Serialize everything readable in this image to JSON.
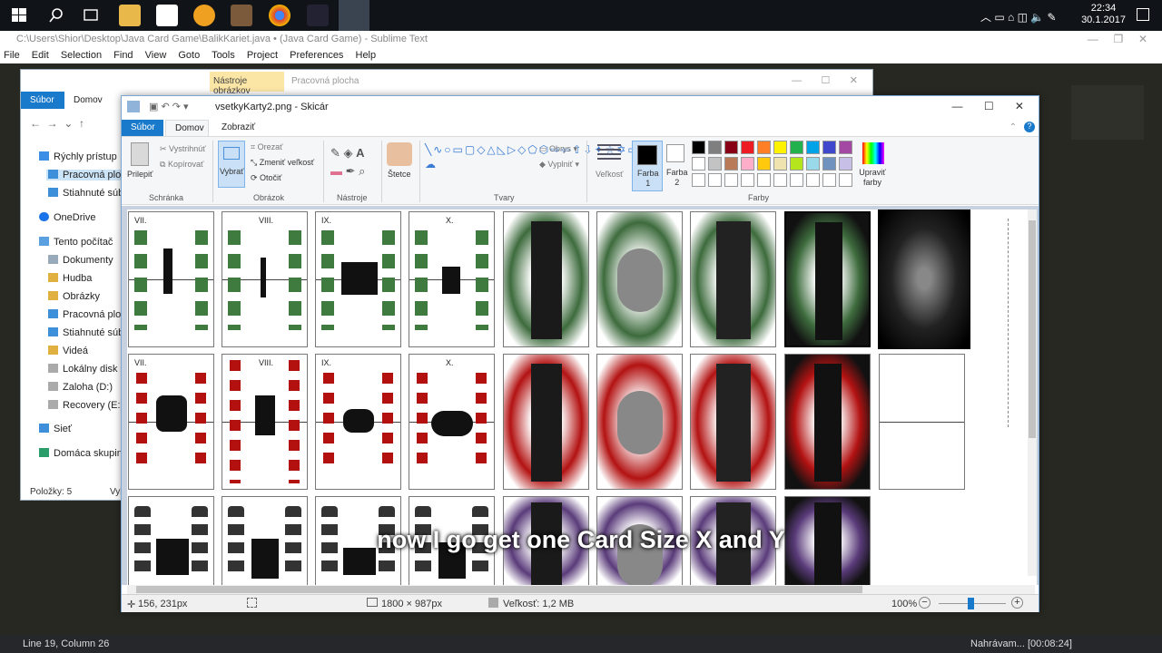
{
  "taskbar": {
    "time": "22:34",
    "date": "30.1.2017"
  },
  "sublime": {
    "title": "C:\\Users\\Shior\\Desktop\\Java Card Game\\BalikKariet.java • (Java Card Game) - Sublime Text",
    "menu": [
      "File",
      "Edit",
      "Selection",
      "Find",
      "View",
      "Goto",
      "Tools",
      "Project",
      "Preferences",
      "Help"
    ],
    "status_left": "Line 19, Column 26",
    "status_right": "Nahrávam... [00:08:24]"
  },
  "explorer": {
    "context_tab": "Nástroje obrázkov",
    "location_tab": "Pracovná plocha",
    "tabs": [
      "Súbor",
      "Domov"
    ],
    "nav": [
      "Rýchly prístup",
      "Pracovná ploch",
      "Stiahnuté súbor",
      "OneDrive",
      "Tento počítač",
      "Dokumenty",
      "Hudba",
      "Obrázky",
      "Pracovná ploch",
      "Stiahnuté súbor",
      "Videá",
      "Lokálny disk (C:",
      "Zaloha (D:)",
      "Recovery (E:)",
      "Sieť",
      "Domáca skupina"
    ],
    "status": "Položky: 5",
    "status2": "Vybratá"
  },
  "paint": {
    "title": "vsetkyKarty2.png - Skicár",
    "tabs": [
      "Súbor",
      "Domov",
      "Zobraziť"
    ],
    "groups": [
      "Schránka",
      "Obrázok",
      "Nástroje",
      "Tvary",
      "Farby"
    ],
    "paste": "Prilepiť",
    "cut": "Vystrihnúť",
    "copy": "Kopírovať",
    "select": "Vybrať",
    "crop": "Orezať",
    "resize": "Zmeniť veľkosť",
    "rotate": "Otočiť",
    "brushes": "Štetce",
    "outline": "Obrys",
    "fill": "Vyplniť",
    "size": "Veľkosť",
    "color1": "Farba",
    "color1n": "1",
    "color2": "Farba",
    "color2n": "2",
    "edit_colors": "Upraviť farby",
    "palette": [
      "#000000",
      "#7f7f7f",
      "#880015",
      "#ed1c24",
      "#ff7f27",
      "#fff200",
      "#22b14c",
      "#00a2e8",
      "#3f48cc",
      "#a349a4",
      "#ffffff",
      "#c3c3c3",
      "#b97a57",
      "#ffaec9",
      "#ffc90e",
      "#efe4b0",
      "#b5e61d",
      "#99d9ea",
      "#7092be",
      "#c8bfe7"
    ],
    "status_pos": "156, 231px",
    "status_dim": "1800 × 987px",
    "status_size": "Veľkosť: 1,2 MB",
    "zoom": "100%"
  },
  "cards": {
    "row1": [
      "VII.",
      "VIII.",
      "IX.",
      "X."
    ],
    "row2": [
      "VII.",
      "VIII.",
      "IX.",
      "X."
    ]
  },
  "caption": "now I go get one Card Size X and Y"
}
